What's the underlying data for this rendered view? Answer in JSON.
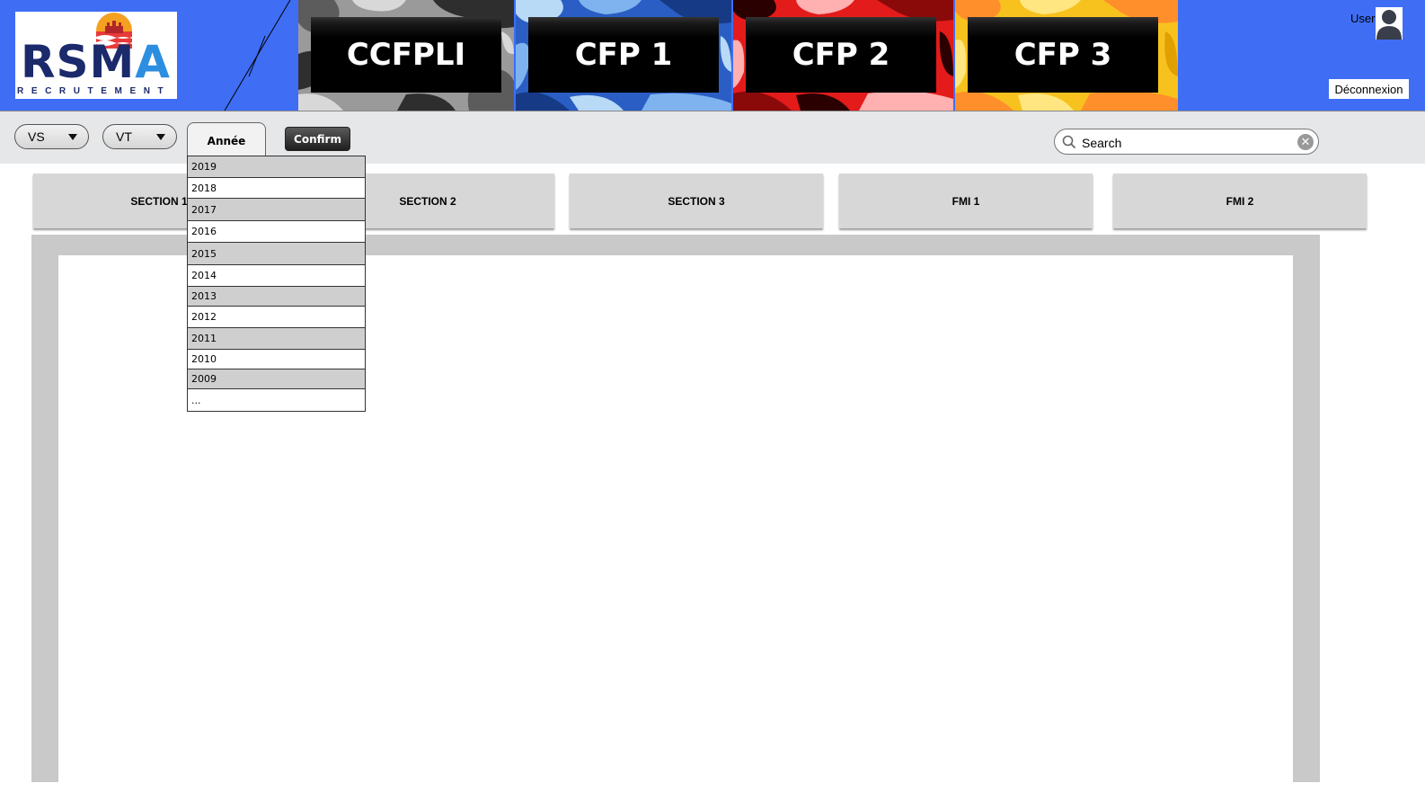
{
  "header": {
    "logo": {
      "text_main_a": "RS",
      "text_main_b": "M",
      "text_main_c": "A",
      "subtitle": "RECRUTEMENT"
    },
    "cfp_buttons": [
      {
        "label": "CCFPLI",
        "camo": "grey"
      },
      {
        "label": "CFP 1",
        "camo": "blue"
      },
      {
        "label": "CFP 2",
        "camo": "red"
      },
      {
        "label": "CFP 3",
        "camo": "yellow"
      }
    ],
    "user_label": "User",
    "logout_label": "Déconnexion"
  },
  "toolbar": {
    "select_vs": "VS",
    "select_vt": "VT",
    "year_tab_label": "Année",
    "confirm_label": "Confirm",
    "search_placeholder": "Search"
  },
  "year_dropdown": {
    "items": [
      "2019",
      "2018",
      "2017",
      "2016",
      "2015",
      "2014",
      "2013",
      "2012",
      "2011",
      "2010",
      "2009",
      "..."
    ]
  },
  "sections": {
    "tabs": [
      "SECTION 1",
      "SECTION 2",
      "SECTION 3",
      "FMI 1",
      "FMI 2"
    ]
  },
  "colors": {
    "header_bg": "#3f6ef5",
    "camo_grey": [
      "#5c5c5c",
      "#9a9a9a",
      "#d8d8d8",
      "#2e2e2e"
    ],
    "camo_blue": [
      "#2a5ec4",
      "#7fb3ef",
      "#173a86",
      "#b8daf7"
    ],
    "camo_red": [
      "#e31b1b",
      "#8a0a0a",
      "#ffb0b0",
      "#2a0000"
    ],
    "camo_yellow": [
      "#f7c21e",
      "#ff8f2a",
      "#ffe680",
      "#e0a000"
    ]
  }
}
